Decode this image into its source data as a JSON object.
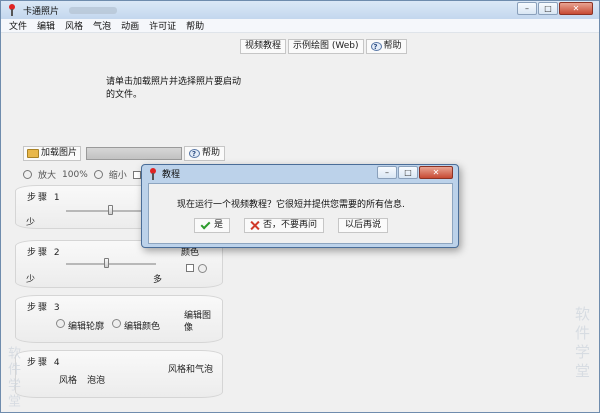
{
  "window": {
    "title": "卡通照片"
  },
  "menu": {
    "items": [
      "文件",
      "编辑",
      "风格",
      "气泡",
      "动画",
      "许可证",
      "帮助"
    ]
  },
  "toolbar": {
    "video_tutorial": "视频教程",
    "sample_drawing": "示例绘图 (Web)",
    "help": "帮助"
  },
  "instruction": "请单击加载照片并选择照片要启动的文件。",
  "load": {
    "load_photo": "加载图片",
    "help": "帮助"
  },
  "zoom": {
    "zoom_in": "放大",
    "zoom_level": "100%",
    "zoom_out": "缩小"
  },
  "steps": {
    "step1": {
      "label": "步骤 1",
      "min_label": "少",
      "slider_value": 0.45
    },
    "step2": {
      "label": "步骤 2",
      "min_label": "少",
      "max_label": "多",
      "color_label": "颜色",
      "slider_value": 0.45
    },
    "step3": {
      "label": "步骤 3",
      "edit_outline": "编辑轮廓",
      "edit_color": "编辑颜色",
      "edit_image": "编辑图像"
    },
    "step4": {
      "label": "步骤 4",
      "style": "风格",
      "bubble": "泡泡",
      "style_bubble": "风格和气泡"
    }
  },
  "dialog": {
    "title": "教程",
    "message": "现在运行一个视频教程？它很短并提供您需要的所有信息.",
    "yes": "是",
    "no_never": "否，不要再问",
    "later": "以后再说"
  },
  "watermark": {
    "right": "软件学堂",
    "left": "软件学堂"
  }
}
